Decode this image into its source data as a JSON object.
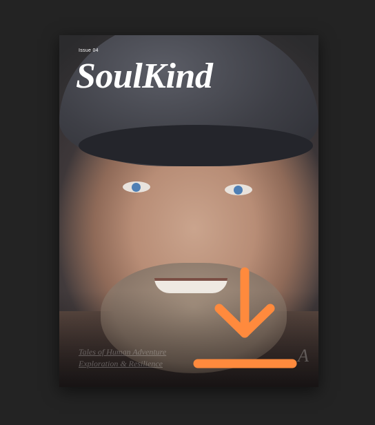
{
  "cover": {
    "issue": "Issue 04",
    "title": "SoulKind",
    "tagline_line1": "Tales of Human Adventure",
    "tagline_line2": "Exploration & Resilience",
    "corner_mark": "A"
  },
  "download": {
    "icon": "download-icon",
    "color": "#FF8A3D"
  },
  "colors": {
    "background": "#232323",
    "accent": "#FF8A3D"
  }
}
